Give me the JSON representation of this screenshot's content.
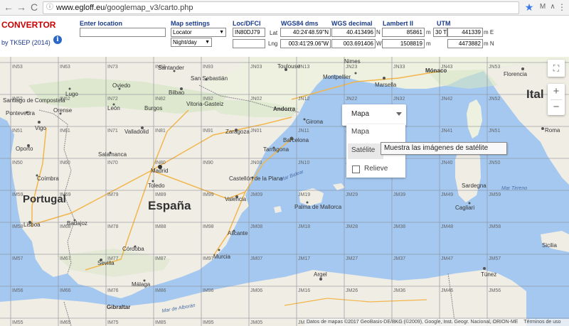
{
  "browser": {
    "url_prefix": "www.egloff.eu",
    "url_path": "/googlemap_v3/carto.php",
    "back": "←",
    "forward": "→",
    "reload": "C",
    "info": "ⓘ",
    "star": "★",
    "ext1": "M",
    "ext2": "∧",
    "ext3": "≡",
    "menu": "⋮"
  },
  "app": {
    "title": "CONVERTOR",
    "author": "by TK5EP (2014)",
    "info_icon": "i"
  },
  "enter_location": {
    "label": "Enter location",
    "value": ""
  },
  "map_settings": {
    "label": "Map settings",
    "mode_value": "Locator",
    "day_value": "Night/day",
    "arrow": "▼"
  },
  "loc": {
    "label": "Loc/DFCI",
    "value": "IN80DJ79",
    "second_value": ""
  },
  "coords": {
    "wgs84_dms_label": "WGS84 dms",
    "wgs_decimal_label": "WGS decimal",
    "lambert_label": "Lambert II",
    "utm_label": "UTM",
    "lat_label": "Lat",
    "lng_label": "Lng",
    "lat_dms": "40:24'48.59\"N",
    "lng_dms": "003:41'29.06\"W",
    "lat_dec": "40.413496",
    "lat_dec_unit": "N",
    "lng_dec": "003.691406",
    "lng_dec_unit": "W",
    "lambert_x": "85861",
    "lambert_y": "1508819",
    "lambert_unit": "m",
    "utm_zone": "30 T",
    "utm_e": "441339",
    "utm_e_unit": "m E",
    "utm_n": "4473882",
    "utm_n_unit": "m N"
  },
  "map": {
    "grid_labels": [
      "IN53",
      "IN63",
      "IN73",
      "IN83",
      "IN93",
      "JN03",
      "JN13",
      "JN23",
      "JN33",
      "JN43",
      "JN53",
      "IN52",
      "IN62",
      "IN72",
      "IN82",
      "IN92",
      "JN02",
      "JN12",
      "JN22",
      "JN32",
      "JN42",
      "JN52",
      "IN51",
      "IN61",
      "IN71",
      "IN81",
      "IN91",
      "JN01",
      "JN11",
      "JN21",
      "JN31",
      "JN41",
      "JN51",
      "IN50",
      "IN60",
      "IN70",
      "IN80",
      "IN90",
      "JN00",
      "JN10",
      "JN20",
      "JN30",
      "JN40",
      "JN50",
      "IM59",
      "IM69",
      "IM79",
      "IM89",
      "IM99",
      "JM09",
      "JM19",
      "JM29",
      "JM39",
      "JM49",
      "JM59",
      "IM58",
      "IM68",
      "IM78",
      "IM88",
      "IM98",
      "JM08",
      "JM18",
      "JM28",
      "JM38",
      "JM48",
      "JM58",
      "IM57",
      "IM67",
      "IM77",
      "IM87",
      "IM97",
      "JM07",
      "JM17",
      "JM27",
      "JM37",
      "JM47",
      "JM57",
      "IM56",
      "IM66",
      "IM76",
      "IM86",
      "IM96",
      "JM06",
      "JM16",
      "JM26",
      "JM36",
      "JM46",
      "JM56",
      "IM55",
      "IM65",
      "IM75",
      "IM85",
      "IM95",
      "JM05",
      "JM15",
      "JM25",
      "JM35",
      "JM45",
      "JM55"
    ],
    "cities": {
      "toulouse": "Toulouse",
      "nimes": "Nimes",
      "monaco": "Mónaco",
      "montpellier": "Montpellier",
      "marsella": "Marsella",
      "florencia": "Florencia",
      "santander": "Santander",
      "san_sebastian": "San Sebastián",
      "bilbao": "Bilbao",
      "vitoria": "Vitoria-Gasteiz",
      "oviedo": "Oviedo",
      "leon": "León",
      "burgos": "Burgos",
      "lugo": "Lugo",
      "santiago": "Santiago de Compostela",
      "pontevedra": "Pontevedra",
      "orense": "Orense",
      "vigo": "Vigo",
      "andorra": "Andorra",
      "zaragoza": "Zaragoza",
      "valladolid": "Valladolid",
      "girona": "Girona",
      "barcelona": "Barcelona",
      "tarragona": "Tarragona",
      "porto": "Oporto",
      "salamanca": "Salamanca",
      "coimbra": "Coímbra",
      "madrid": "Madrid",
      "toledo": "Toledo",
      "castellon": "Castellón de la Plana",
      "valencia": "Valencia",
      "lisboa": "Lisboa",
      "badajoz": "Badajoz",
      "palma": "Palma de Mallorca",
      "alicante": "Alicante",
      "cordoba": "Córdoba",
      "murcia": "Murcia",
      "sevilla": "Sevilla",
      "malaga": "Málaga",
      "gibraltar": "Gibraltar",
      "argel": "Argel",
      "tunez": "Túnez",
      "roma": "Roma",
      "sardegna": "Sardegna",
      "cagliari": "Cagliari",
      "sicilia": "Sicilia"
    },
    "countries": {
      "portugal": "Portugal",
      "espana": "España",
      "italia": "Ital"
    },
    "seas": {
      "balear": "Mar Balear",
      "tirreno": "Mar Tirreno",
      "alboran": "Mar de Alborán"
    }
  },
  "maptype": {
    "selected": "Mapa",
    "options": [
      "Mapa",
      "Satélite"
    ],
    "relieve_label": "Relieve",
    "tooltip": "Muestra las imágenes de satélite"
  },
  "controls": {
    "fullscreen": "⛶",
    "zoom_in": "+",
    "zoom_out": "−"
  },
  "attribution": {
    "text": "Datos de mapas ©2017 GeoBasis-DE/BKG (©2009), Google, Inst. Geogr. Nacional, ORION-ME",
    "terms": "Términos de uso"
  }
}
